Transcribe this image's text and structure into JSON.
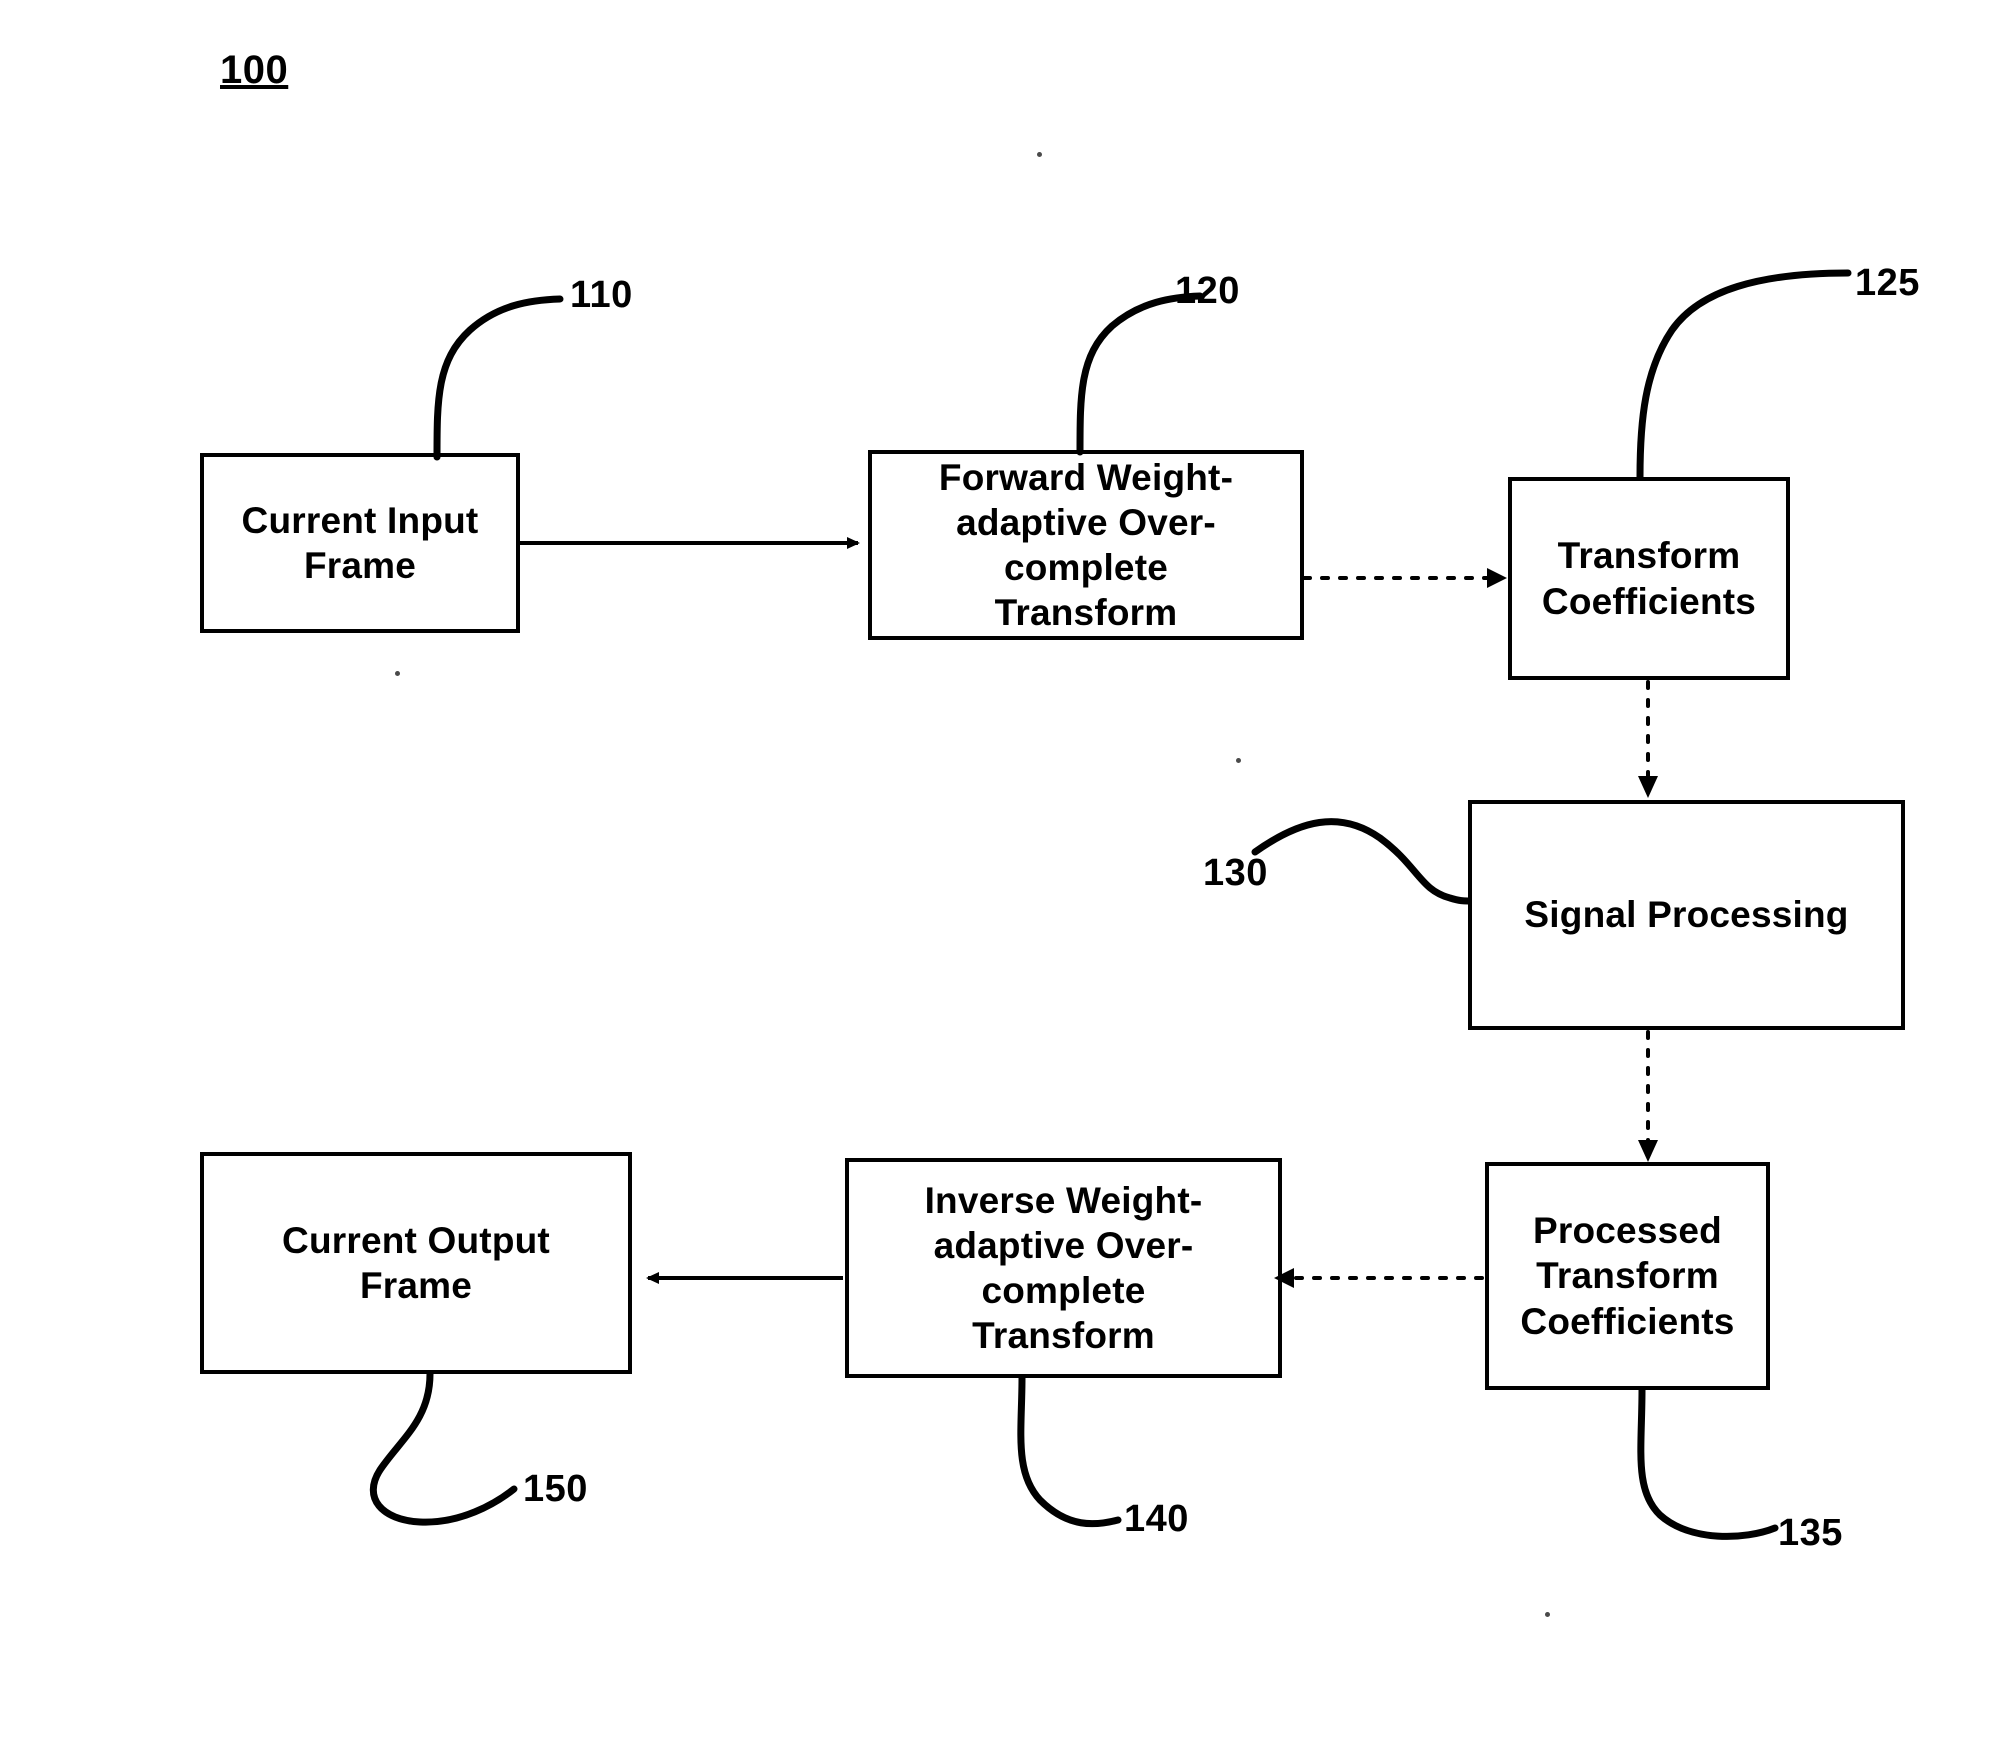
{
  "figure": {
    "number": "100"
  },
  "colors": {
    "ink": "#000000",
    "paper": "#ffffff"
  },
  "nodes": [
    {
      "id": "110",
      "name": "current-input-frame",
      "label": "Current Input\nFrame",
      "ref": "110"
    },
    {
      "id": "120",
      "name": "forward-transform",
      "label": "Forward Weight-\nadaptive Over-\ncomplete\nTransform",
      "ref": "120"
    },
    {
      "id": "125",
      "name": "transform-coefficients",
      "label": "Transform\nCoefficients",
      "ref": "125"
    },
    {
      "id": "130",
      "name": "signal-processing",
      "label": "Signal Processing",
      "ref": "130"
    },
    {
      "id": "135",
      "name": "processed-transform-coefficients",
      "label": "Processed\nTransform\nCoefficients",
      "ref": "135"
    },
    {
      "id": "140",
      "name": "inverse-transform",
      "label": "Inverse Weight-\nadaptive Over-\ncomplete\nTransform",
      "ref": "140"
    },
    {
      "id": "150",
      "name": "current-output-frame",
      "label": "Current Output\nFrame",
      "ref": "150"
    }
  ],
  "refs": {
    "r110": "110",
    "r120": "120",
    "r125": "125",
    "r130": "130",
    "r135": "135",
    "r140": "140",
    "r150": "150"
  },
  "connections": [
    {
      "from": "110",
      "to": "120",
      "style": "solid"
    },
    {
      "from": "120",
      "to": "125",
      "style": "dotted"
    },
    {
      "from": "125",
      "to": "130",
      "style": "dotted"
    },
    {
      "from": "130",
      "to": "135",
      "style": "dotted"
    },
    {
      "from": "135",
      "to": "140",
      "style": "dotted"
    },
    {
      "from": "140",
      "to": "150",
      "style": "solid"
    }
  ]
}
